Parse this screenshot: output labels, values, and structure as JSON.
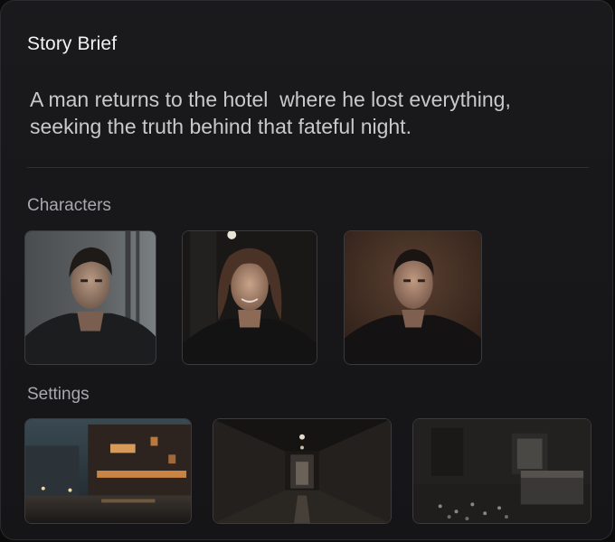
{
  "brief": {
    "title": "Story Brief",
    "text": "A man returns to the hotel  where he lost everything,\nseeking the truth behind that fateful night."
  },
  "characters": {
    "label": "Characters",
    "items": [
      {
        "icon": "character-portrait-man-dark-jacket"
      },
      {
        "icon": "character-portrait-woman-smiling"
      },
      {
        "icon": "character-portrait-man-warm-background"
      }
    ]
  },
  "settings": {
    "label": "Settings",
    "items": [
      {
        "icon": "setting-rainy-night-street"
      },
      {
        "icon": "setting-dim-hotel-corridor"
      },
      {
        "icon": "setting-abandoned-hotel-room"
      }
    ]
  },
  "colors": {
    "card_bg": "#18181a",
    "border": "#2c2c30",
    "title": "#f2f2f2",
    "body_text": "#c9c9cc",
    "section_label": "#a8a8ad"
  }
}
